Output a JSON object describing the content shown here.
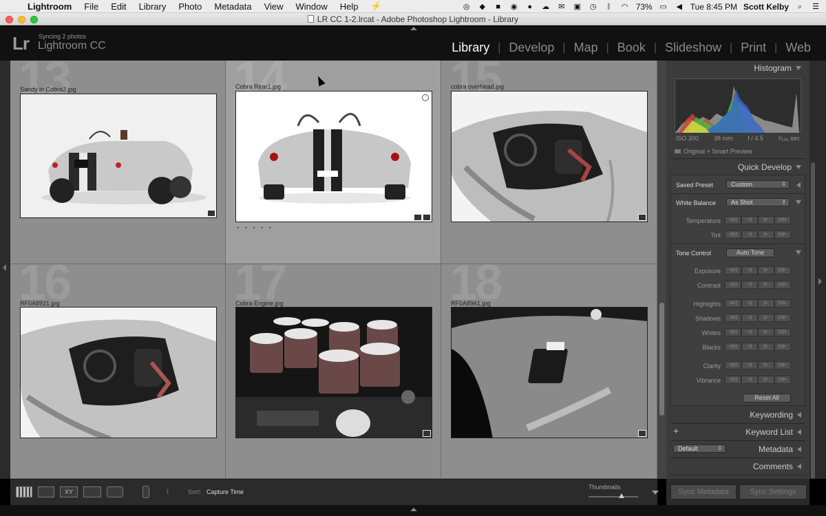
{
  "menubar": {
    "app_name": "Lightroom",
    "items": [
      "File",
      "Edit",
      "Library",
      "Photo",
      "Metadata",
      "View",
      "Window",
      "Help"
    ],
    "battery": "73%",
    "clock": "Tue 8:45 PM",
    "user": "Scott Kelby"
  },
  "window": {
    "title": "LR CC 1-2.lrcat - Adobe Photoshop Lightroom - Library"
  },
  "identity": {
    "logo": "Lr",
    "sync_status": "Syncing 2 photos",
    "product": "Lightroom CC"
  },
  "modules": [
    "Library",
    "Develop",
    "Map",
    "Book",
    "Slideshow",
    "Print",
    "Web"
  ],
  "active_module": "Library",
  "grid": {
    "cells": [
      {
        "number": "13",
        "filename": "Sandy in Cobra2.jpg"
      },
      {
        "number": "14",
        "filename": "Cobra Rear1.jpg"
      },
      {
        "number": "15",
        "filename": "cobra overhead.jpg"
      },
      {
        "number": "16",
        "filename": "RF0A8921.jpg"
      },
      {
        "number": "17",
        "filename": "Cobra Engine.jpg"
      },
      {
        "number": "18",
        "filename": "RF0A8961.jpg"
      }
    ],
    "selected_index": 1
  },
  "histogram": {
    "title": "Histogram",
    "iso": "ISO 200",
    "focal": "38 mm",
    "aperture": "f / 4.5",
    "shutter": "¹⁄₁₂₅ sec",
    "preview": "Original + Smart Preview"
  },
  "quick_develop": {
    "title": "Quick Develop",
    "saved_preset_label": "Saved Preset",
    "saved_preset_value": "Custom",
    "white_balance_label": "White Balance",
    "white_balance_value": "As Shot",
    "temperature": "Temperature",
    "tint": "Tint",
    "tone_control_label": "Tone Control",
    "auto_tone": "Auto Tone",
    "exposure": "Exposure",
    "contrast": "Contrast",
    "highlights": "Highlights",
    "shadows": "Shadows",
    "whites": "Whites",
    "blacks": "Blacks",
    "clarity": "Clarity",
    "vibrance": "Vibrance",
    "reset_all": "Reset All",
    "steps": [
      "◁◁",
      "◁",
      "▷",
      "▷▷"
    ]
  },
  "panels": {
    "keywording": "Keywording",
    "keyword_list": "Keyword List",
    "metadata": "Metadata",
    "metadata_preset": "Default",
    "comments": "Comments"
  },
  "toolbar": {
    "sort_label": "Sort:",
    "sort_value": "Capture Time",
    "thumbnails_label": "Thumbnails"
  },
  "sync": {
    "sync_metadata": "Sync Metadata",
    "sync_settings": "Sync Settings"
  }
}
